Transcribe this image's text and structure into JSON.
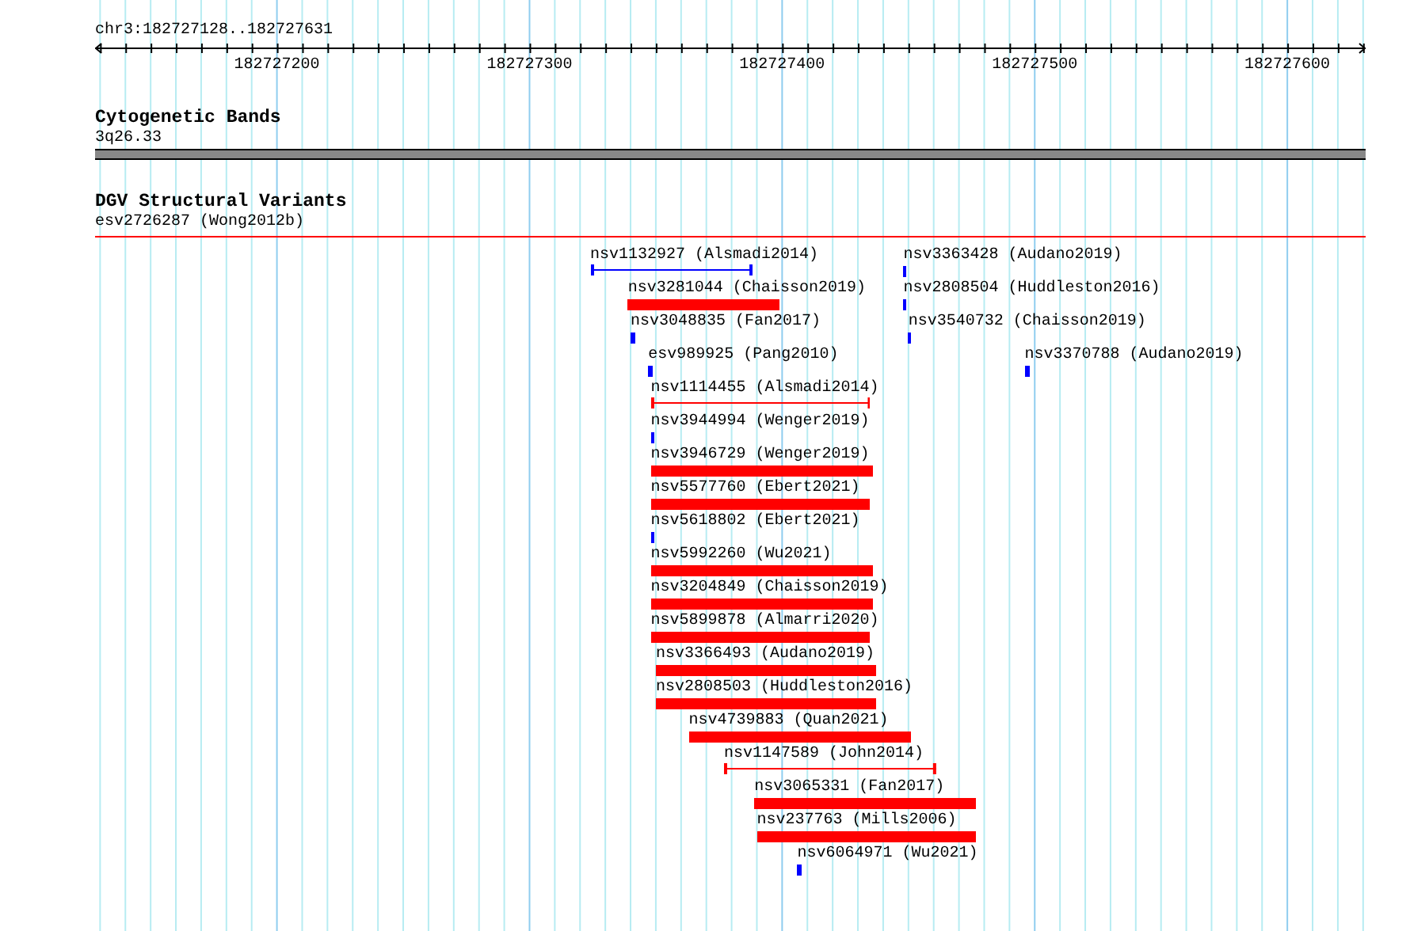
{
  "location": "chr3:182727128..182727631",
  "ruler": {
    "ticks": [
      "182727200",
      "182727300",
      "182727400",
      "182727500",
      "182727600"
    ]
  },
  "tracks": [
    {
      "kind": "band",
      "title": "Cytogenetic Bands",
      "label": "3q26.33"
    },
    {
      "kind": "features",
      "title": "DGV Structural Variants",
      "features": [
        {
          "label": "esv2726287 (Wong2012b)",
          "kind": "line",
          "color": "#ff0000"
        },
        {
          "label": "nsv1132927 (Alsmadi2014)",
          "kind": "line",
          "color": "#0000ff"
        },
        {
          "label": "nsv3363428 (Audano2019)",
          "kind": "bar",
          "color": "#0000ff"
        },
        {
          "label": "nsv3281044 (Chaisson2019)",
          "kind": "bar",
          "color": "#ff0000"
        },
        {
          "label": "nsv2808504 (Huddleston2016)",
          "kind": "bar",
          "color": "#0000ff"
        },
        {
          "label": "nsv3048835 (Fan2017)",
          "kind": "bar",
          "color": "#0000ff"
        },
        {
          "label": "nsv3540732 (Chaisson2019)",
          "kind": "bar",
          "color": "#0000ff"
        },
        {
          "label": "esv989925 (Pang2010)",
          "kind": "bar",
          "color": "#0000ff"
        },
        {
          "label": "nsv3370788 (Audano2019)",
          "kind": "bar",
          "color": "#0000ff"
        },
        {
          "label": "nsv1114455 (Alsmadi2014)",
          "kind": "line",
          "color": "#ff0000"
        },
        {
          "label": "nsv3944994 (Wenger2019)",
          "kind": "bar",
          "color": "#0000ff"
        },
        {
          "label": "nsv3946729 (Wenger2019)",
          "kind": "bar",
          "color": "#ff0000"
        },
        {
          "label": "nsv5577760 (Ebert2021)",
          "kind": "bar",
          "color": "#ff0000"
        },
        {
          "label": "nsv5618802 (Ebert2021)",
          "kind": "bar",
          "color": "#0000ff"
        },
        {
          "label": "nsv5992260 (Wu2021)",
          "kind": "bar",
          "color": "#ff0000"
        },
        {
          "label": "nsv3204849 (Chaisson2019)",
          "kind": "bar",
          "color": "#ff0000"
        },
        {
          "label": "nsv5899878 (Almarri2020)",
          "kind": "bar",
          "color": "#ff0000"
        },
        {
          "label": "nsv3366493 (Audano2019)",
          "kind": "bar",
          "color": "#ff0000"
        },
        {
          "label": "nsv2808503 (Huddleston2016)",
          "kind": "bar",
          "color": "#ff0000"
        },
        {
          "label": "nsv4739883 (Quan2021)",
          "kind": "bar",
          "color": "#ff0000"
        },
        {
          "label": "nsv1147589 (John2014)",
          "kind": "line",
          "color": "#ff0000"
        },
        {
          "label": "nsv3065331 (Fan2017)",
          "kind": "bar",
          "color": "#ff0000"
        },
        {
          "label": "nsv237763 (Mills2006)",
          "kind": "bar",
          "color": "#ff0000"
        },
        {
          "label": "nsv6064971 (Wu2021)",
          "kind": "bar",
          "color": "#0000ff"
        }
      ]
    }
  ]
}
